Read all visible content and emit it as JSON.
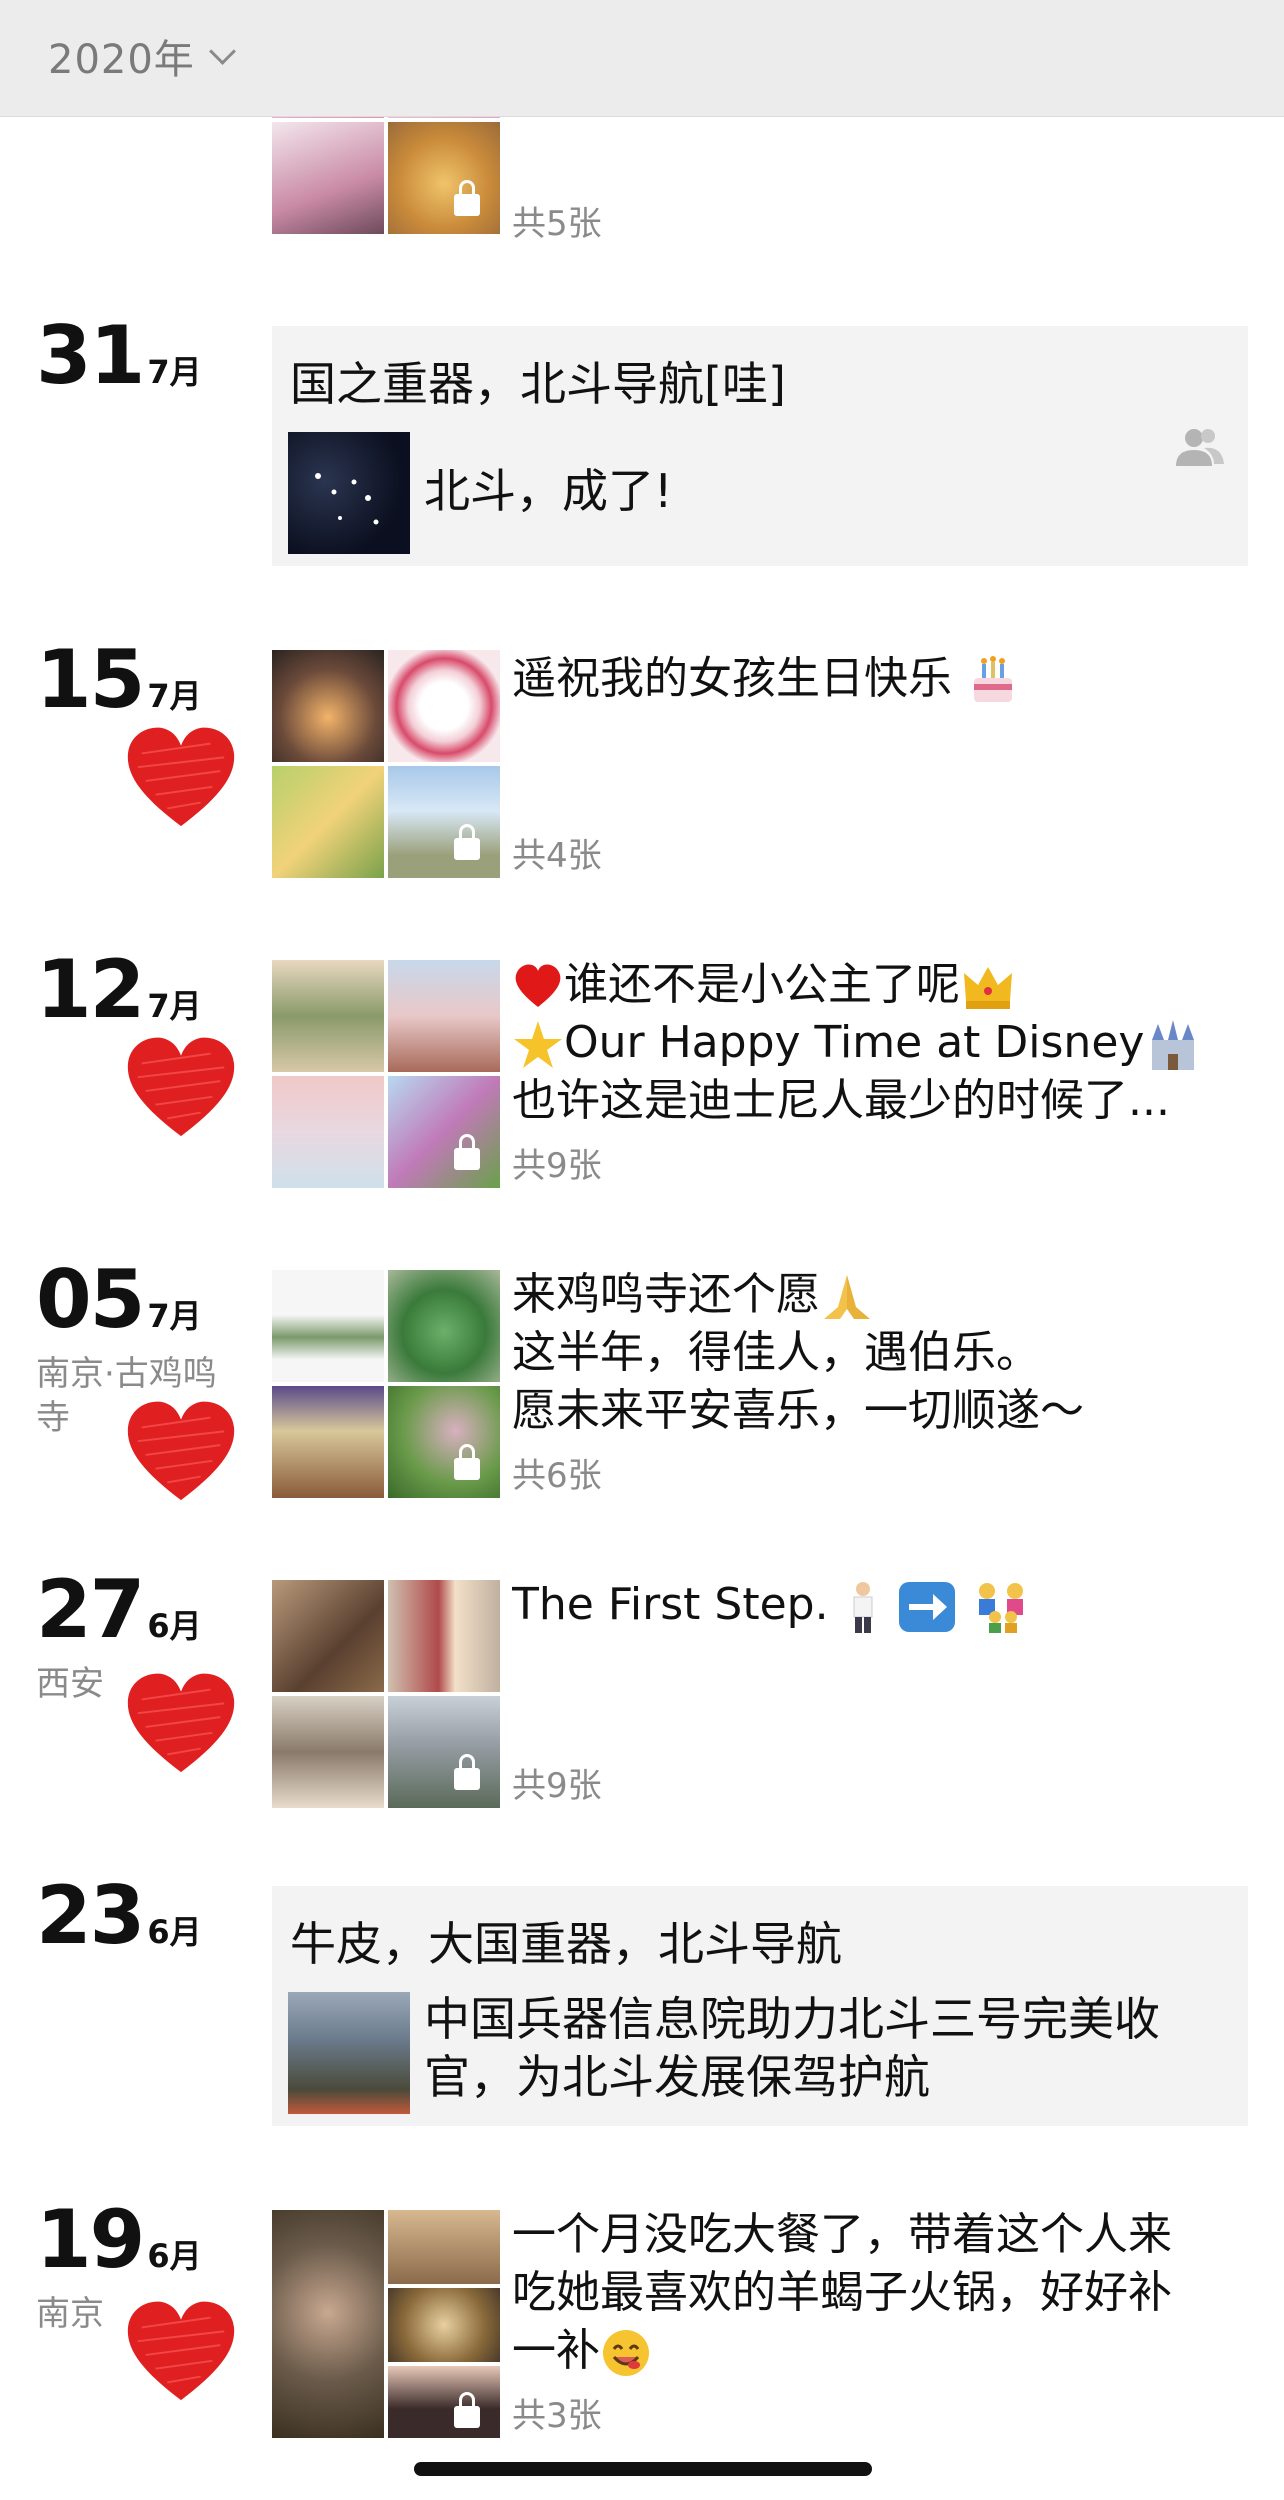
{
  "header": {
    "year": "2020年"
  },
  "top_partial": {
    "count": "共5张"
  },
  "entries": [
    {
      "day": "31",
      "month": "7月",
      "share_title": "国之重器，北斗导航[哇]",
      "share_text": "北斗，成了!"
    },
    {
      "day": "15",
      "month": "7月",
      "text": "遥祝我的女孩生日快乐",
      "count": "共4张"
    },
    {
      "day": "12",
      "month": "7月",
      "lines": [
        "谁还不是小公主了呢",
        "Our Happy Time at Disney",
        "也许这是迪士尼人最少的时候了..."
      ],
      "count": "共9张"
    },
    {
      "day": "05",
      "month": "7月",
      "location": "南京·古鸡鸣寺",
      "lines": [
        "来鸡鸣寺还个愿",
        "这半年，得佳人，遇伯乐。",
        "愿未来平安喜乐，一切顺遂～"
      ],
      "count": "共6张"
    },
    {
      "day": "27",
      "month": "6月",
      "location": "西安",
      "text": "The First Step.",
      "count": "共9张"
    },
    {
      "day": "23",
      "month": "6月",
      "share_title": "牛皮，大国重器，北斗导航",
      "share_lines": [
        "中国兵器信息院助力北斗三号完美收",
        "官，为北斗发展保驾护航"
      ]
    },
    {
      "day": "19",
      "month": "6月",
      "location": "南京",
      "lines": [
        "一个月没吃大餐了，带着这个人来",
        "吃她最喜欢的羊蝎子火锅，好好补",
        "一补"
      ],
      "count": "共3张"
    }
  ],
  "colors": {
    "heart": "#e02020",
    "header_bg": "#ececec",
    "card_bg": "#f3f3f3",
    "muted": "#8a8a8a"
  },
  "icons": [
    "chevron-down-icon",
    "heart-icon",
    "lock-icon",
    "people-icon"
  ]
}
